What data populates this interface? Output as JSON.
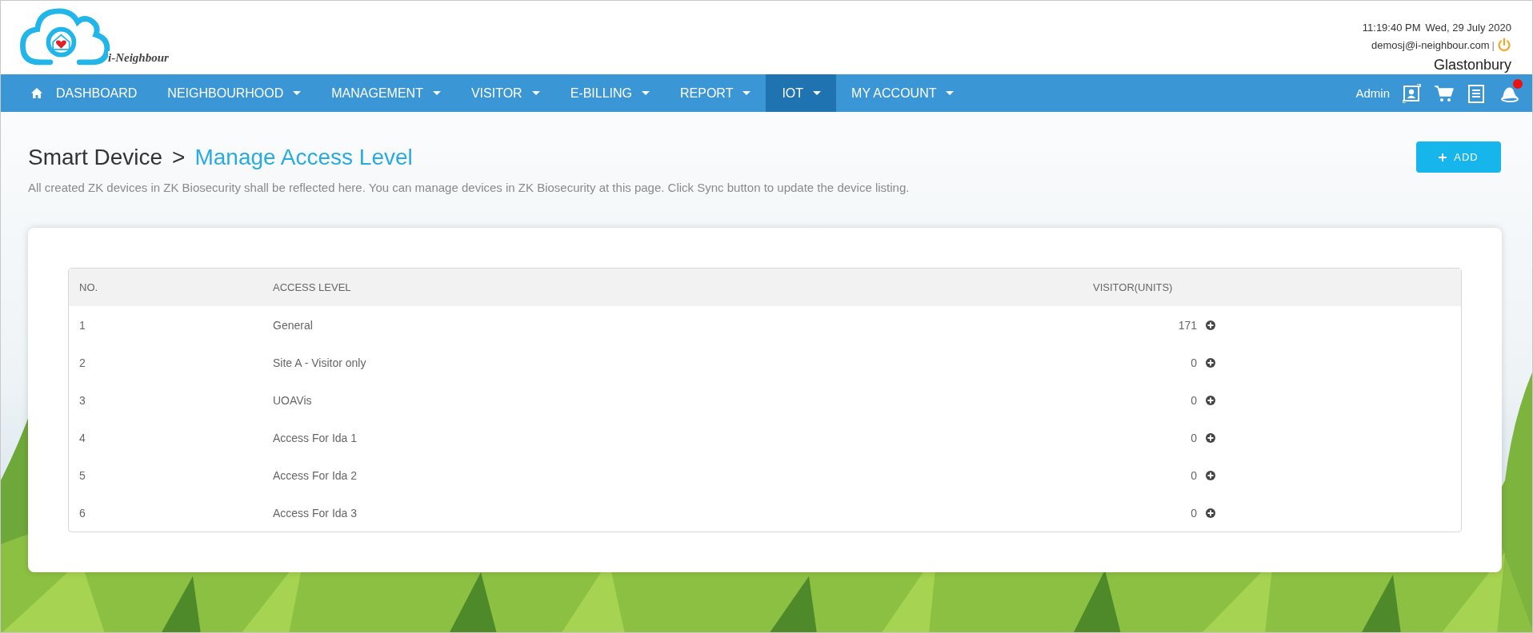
{
  "header": {
    "logo_text": "i-Neighbour",
    "time": "11:19:40 PM",
    "date": "Wed, 29 July 2020",
    "email": "demosj@i-neighbour.com",
    "separator": "|",
    "location": "Glastonbury"
  },
  "nav": {
    "items": [
      {
        "label": "DASHBOARD",
        "kind": "home",
        "has_menu": false,
        "selected": false
      },
      {
        "label": "NEIGHBOURHOOD",
        "kind": "plain",
        "has_menu": true,
        "selected": false
      },
      {
        "label": "MANAGEMENT",
        "kind": "plain",
        "has_menu": true,
        "selected": false
      },
      {
        "label": "VISITOR",
        "kind": "plain",
        "has_menu": true,
        "selected": false
      },
      {
        "label": "E-BILLING",
        "kind": "plain",
        "has_menu": true,
        "selected": false
      },
      {
        "label": "REPORT",
        "kind": "plain",
        "has_menu": true,
        "selected": false
      },
      {
        "label": "IOT",
        "kind": "plain",
        "has_menu": true,
        "selected": true
      },
      {
        "label": "MY ACCOUNT",
        "kind": "plain",
        "has_menu": true,
        "selected": false
      }
    ],
    "user": "Admin",
    "notification_unread": true
  },
  "page": {
    "breadcrumb_parent": "Smart Device",
    "breadcrumb_separator": ">",
    "title": "Manage Access Level",
    "add_button": "ADD",
    "description": "All created ZK devices in ZK Biosecurity shall be reflected here. You can manage devices in ZK Biosecurity at this page. Click Sync button to update the device listing."
  },
  "table": {
    "columns": [
      "NO.",
      "ACCESS LEVEL",
      "VISITOR(UNITS)"
    ],
    "rows": [
      {
        "no": "1",
        "access_level": "General",
        "visitor_units": "171"
      },
      {
        "no": "2",
        "access_level": "Site A - Visitor only",
        "visitor_units": "0"
      },
      {
        "no": "3",
        "access_level": "UOAVis",
        "visitor_units": "0"
      },
      {
        "no": "4",
        "access_level": "Access For Ida 1",
        "visitor_units": "0"
      },
      {
        "no": "5",
        "access_level": "Access For Ida 2",
        "visitor_units": "0"
      },
      {
        "no": "6",
        "access_level": "Access For Ida 3",
        "visitor_units": "0"
      }
    ]
  }
}
